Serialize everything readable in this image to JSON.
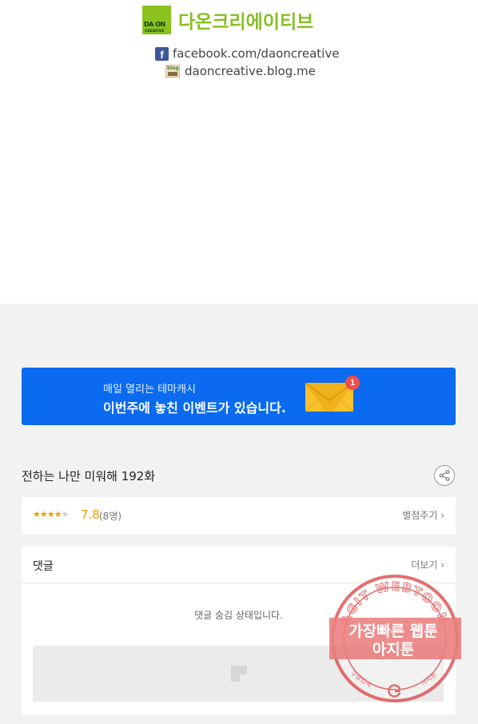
{
  "header": {
    "brand_name": "다온크리에이티브",
    "logo_text": "DA ON",
    "logo_sub": "CREATIVE",
    "facebook_link": "facebook.com/daoncreative",
    "blog_link": "daoncreative.blog.me",
    "blog_icon_text": "blog"
  },
  "banner": {
    "line1": "매일 열리는 테마캐시",
    "line2": "이번주에 놓친 이벤트가 있습니다.",
    "badge_count": "1"
  },
  "episode": {
    "title": "전하는 나만 미워해 192화"
  },
  "rating": {
    "stars_filled": "★★★★",
    "stars_empty": "★",
    "score": "7.8",
    "count": "(8명)",
    "rate_label": "별점주기 ›"
  },
  "comments": {
    "title": "댓글",
    "more_label": "더보기 ›",
    "hidden_message": "댓글 숨김 상태입니다."
  },
  "watermark": {
    "arc_text": "AGIT WEBTOON",
    "line1": "가장빠른 웹툰",
    "line2": "아지툰",
    "bottom_left": "구글검색",
    "bottom_right": "아지툰"
  },
  "colors": {
    "brand_green": "#86bf22",
    "banner_blue": "#0a6af0",
    "rating_orange": "#f29a00",
    "stamp_red": "#e05555"
  }
}
